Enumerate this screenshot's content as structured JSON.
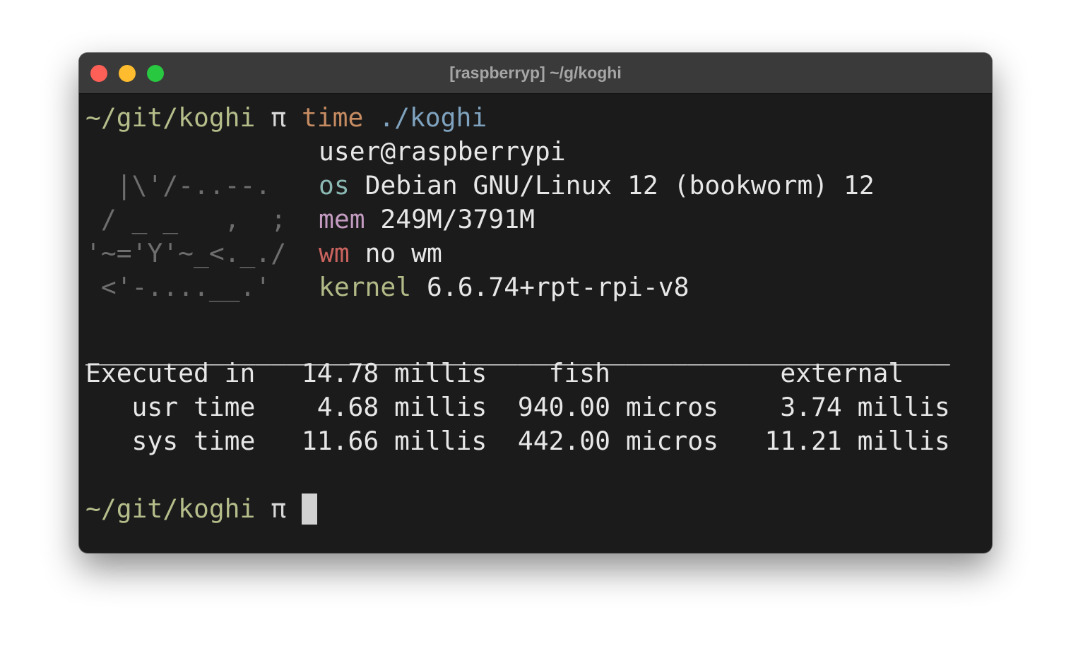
{
  "window": {
    "title": "[raspberryp] ~/g/koghi"
  },
  "prompt": {
    "path": "~/git/koghi",
    "symbol": "π",
    "command": "time",
    "argument": "./koghi"
  },
  "logo": {
    "lines": [
      "  |\\'/-..--.",
      " / _ _   ,  ;",
      "'~='Y'~_<._./",
      " <'-....__.'"
    ]
  },
  "info": {
    "user_host": "user@raspberrypi",
    "os_label": "os",
    "os_value": "Debian GNU/Linux 12 (bookworm) 12",
    "mem_label": "mem",
    "mem_value": "249M/3791M",
    "wm_label": "wm",
    "wm_value": "no wm",
    "kernel_label": "kernel",
    "kernel_value": "6.6.74+rpt-rpi-v8"
  },
  "timing": {
    "separator": "________________________________________________________",
    "header": "Executed in   14.78 millis    fish           external",
    "rows": [
      "   usr time    4.68 millis  940.00 micros    3.74 millis",
      "   sys time   11.66 millis  442.00 micros   11.21 millis"
    ]
  },
  "prompt2": {
    "path": "~/git/koghi",
    "symbol": "π"
  }
}
